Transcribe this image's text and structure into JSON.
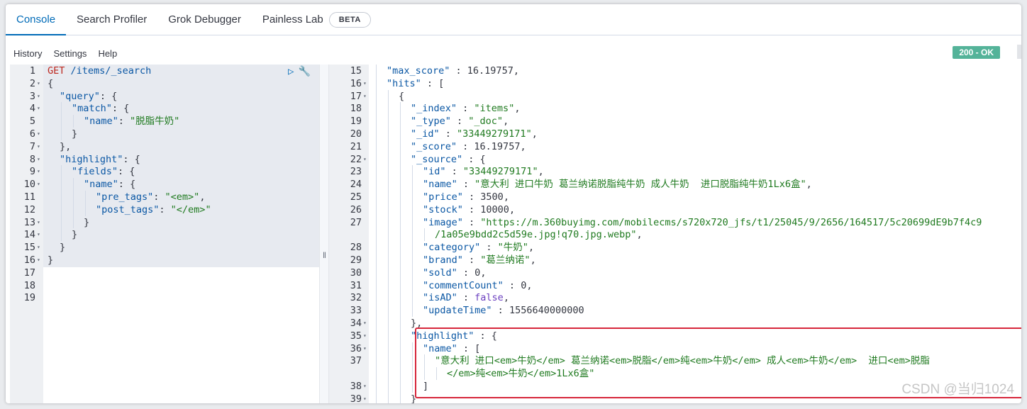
{
  "tabs": [
    "Console",
    "Search Profiler",
    "Grok Debugger",
    "Painless Lab"
  ],
  "beta_badge": "BETA",
  "menu": [
    "History",
    "Settings",
    "Help"
  ],
  "status_badge": "200 - OK",
  "request_lines": [
    {
      "n": "1",
      "fold": false,
      "ind": 0,
      "t": [
        [
          "m",
          "GET "
        ],
        [
          "k",
          "/items/_search"
        ]
      ]
    },
    {
      "n": "2",
      "fold": true,
      "ind": 0,
      "t": [
        [
          "p",
          "{"
        ]
      ]
    },
    {
      "n": "3",
      "fold": true,
      "ind": 1,
      "t": [
        [
          "k",
          "\"query\""
        ],
        [
          "p",
          ": {"
        ]
      ]
    },
    {
      "n": "4",
      "fold": true,
      "ind": 2,
      "t": [
        [
          "k",
          "\"match\""
        ],
        [
          "p",
          ": {"
        ]
      ]
    },
    {
      "n": "5",
      "fold": false,
      "ind": 3,
      "t": [
        [
          "k",
          "\"name\""
        ],
        [
          "p",
          ": "
        ],
        [
          "s",
          "\"脱脂牛奶\""
        ]
      ]
    },
    {
      "n": "6",
      "fold": true,
      "ind": 2,
      "t": [
        [
          "p",
          "}"
        ]
      ]
    },
    {
      "n": "7",
      "fold": true,
      "ind": 1,
      "t": [
        [
          "p",
          "},"
        ]
      ]
    },
    {
      "n": "8",
      "fold": true,
      "ind": 1,
      "t": [
        [
          "k",
          "\"highlight\""
        ],
        [
          "p",
          ": {"
        ]
      ]
    },
    {
      "n": "9",
      "fold": true,
      "ind": 2,
      "t": [
        [
          "k",
          "\"fields\""
        ],
        [
          "p",
          ": {"
        ]
      ]
    },
    {
      "n": "10",
      "fold": true,
      "ind": 3,
      "t": [
        [
          "k",
          "\"name\""
        ],
        [
          "p",
          ": {"
        ]
      ]
    },
    {
      "n": "11",
      "fold": false,
      "ind": 4,
      "t": [
        [
          "k",
          "\"pre_tags\""
        ],
        [
          "p",
          ": "
        ],
        [
          "s",
          "\"<em>\""
        ],
        [
          "p",
          ","
        ]
      ]
    },
    {
      "n": "12",
      "fold": false,
      "ind": 4,
      "t": [
        [
          "k",
          "\"post_tags\""
        ],
        [
          "p",
          ": "
        ],
        [
          "s",
          "\"</em>\""
        ]
      ]
    },
    {
      "n": "13",
      "fold": true,
      "ind": 3,
      "t": [
        [
          "p",
          "}"
        ]
      ]
    },
    {
      "n": "14",
      "fold": true,
      "ind": 2,
      "t": [
        [
          "p",
          "}"
        ]
      ]
    },
    {
      "n": "15",
      "fold": true,
      "ind": 1,
      "t": [
        [
          "p",
          "}"
        ]
      ]
    },
    {
      "n": "16",
      "fold": true,
      "ind": 0,
      "t": [
        [
          "p",
          "}"
        ]
      ]
    },
    {
      "n": "17",
      "fold": false,
      "ind": 0,
      "t": []
    },
    {
      "n": "18",
      "fold": false,
      "ind": 0,
      "t": []
    },
    {
      "n": "19",
      "fold": false,
      "ind": 0,
      "t": []
    }
  ],
  "response_lines": [
    {
      "n": "15",
      "fold": false,
      "ind": 1,
      "t": [
        [
          "k",
          "\"max_score\""
        ],
        [
          "p",
          " : "
        ],
        [
          "n",
          "16.19757"
        ],
        [
          "p",
          ","
        ]
      ]
    },
    {
      "n": "16",
      "fold": true,
      "ind": 1,
      "t": [
        [
          "k",
          "\"hits\""
        ],
        [
          "p",
          " : ["
        ]
      ]
    },
    {
      "n": "17",
      "fold": true,
      "ind": 2,
      "t": [
        [
          "p",
          "{"
        ]
      ]
    },
    {
      "n": "18",
      "fold": false,
      "ind": 3,
      "t": [
        [
          "k",
          "\"_index\""
        ],
        [
          "p",
          " : "
        ],
        [
          "s",
          "\"items\""
        ],
        [
          "p",
          ","
        ]
      ]
    },
    {
      "n": "19",
      "fold": false,
      "ind": 3,
      "t": [
        [
          "k",
          "\"_type\""
        ],
        [
          "p",
          " : "
        ],
        [
          "s",
          "\"_doc\""
        ],
        [
          "p",
          ","
        ]
      ]
    },
    {
      "n": "20",
      "fold": false,
      "ind": 3,
      "t": [
        [
          "k",
          "\"_id\""
        ],
        [
          "p",
          " : "
        ],
        [
          "s",
          "\"33449279171\""
        ],
        [
          "p",
          ","
        ]
      ]
    },
    {
      "n": "21",
      "fold": false,
      "ind": 3,
      "t": [
        [
          "k",
          "\"_score\""
        ],
        [
          "p",
          " : "
        ],
        [
          "n",
          "16.19757"
        ],
        [
          "p",
          ","
        ]
      ]
    },
    {
      "n": "22",
      "fold": true,
      "ind": 3,
      "t": [
        [
          "k",
          "\"_source\""
        ],
        [
          "p",
          " : {"
        ]
      ]
    },
    {
      "n": "23",
      "fold": false,
      "ind": 4,
      "t": [
        [
          "k",
          "\"id\""
        ],
        [
          "p",
          " : "
        ],
        [
          "s",
          "\"33449279171\""
        ],
        [
          "p",
          ","
        ]
      ]
    },
    {
      "n": "24",
      "fold": false,
      "ind": 4,
      "t": [
        [
          "k",
          "\"name\""
        ],
        [
          "p",
          " : "
        ],
        [
          "s",
          "\"意大利 进口牛奶 葛兰纳诺脱脂纯牛奶 成人牛奶  进口脱脂纯牛奶1Lx6盒\""
        ],
        [
          "p",
          ","
        ]
      ]
    },
    {
      "n": "25",
      "fold": false,
      "ind": 4,
      "t": [
        [
          "k",
          "\"price\""
        ],
        [
          "p",
          " : "
        ],
        [
          "n",
          "3500"
        ],
        [
          "p",
          ","
        ]
      ]
    },
    {
      "n": "26",
      "fold": false,
      "ind": 4,
      "t": [
        [
          "k",
          "\"stock\""
        ],
        [
          "p",
          " : "
        ],
        [
          "n",
          "10000"
        ],
        [
          "p",
          ","
        ]
      ]
    },
    {
      "n": "27",
      "fold": false,
      "ind": 4,
      "t": [
        [
          "k",
          "\"image\""
        ],
        [
          "p",
          " : "
        ],
        [
          "s",
          "\"https://m.360buyimg.com/mobilecms/s720x720_jfs/t1/25045/9/2656/164517/5c20699dE9b7f4c9"
        ]
      ]
    },
    {
      "n": "",
      "fold": false,
      "ind": 5,
      "t": [
        [
          "s",
          "/1a05e9bdd2c5d59e.jpg!q70.jpg.webp\""
        ],
        [
          "p",
          ","
        ]
      ]
    },
    {
      "n": "28",
      "fold": false,
      "ind": 4,
      "t": [
        [
          "k",
          "\"category\""
        ],
        [
          "p",
          " : "
        ],
        [
          "s",
          "\"牛奶\""
        ],
        [
          "p",
          ","
        ]
      ]
    },
    {
      "n": "29",
      "fold": false,
      "ind": 4,
      "t": [
        [
          "k",
          "\"brand\""
        ],
        [
          "p",
          " : "
        ],
        [
          "s",
          "\"葛兰纳诺\""
        ],
        [
          "p",
          ","
        ]
      ]
    },
    {
      "n": "30",
      "fold": false,
      "ind": 4,
      "t": [
        [
          "k",
          "\"sold\""
        ],
        [
          "p",
          " : "
        ],
        [
          "n",
          "0"
        ],
        [
          "p",
          ","
        ]
      ]
    },
    {
      "n": "31",
      "fold": false,
      "ind": 4,
      "t": [
        [
          "k",
          "\"commentCount\""
        ],
        [
          "p",
          " : "
        ],
        [
          "n",
          "0"
        ],
        [
          "p",
          ","
        ]
      ]
    },
    {
      "n": "32",
      "fold": false,
      "ind": 4,
      "t": [
        [
          "k",
          "\"isAD\""
        ],
        [
          "p",
          " : "
        ],
        [
          "b",
          "false"
        ],
        [
          "p",
          ","
        ]
      ]
    },
    {
      "n": "33",
      "fold": false,
      "ind": 4,
      "t": [
        [
          "k",
          "\"updateTime\""
        ],
        [
          "p",
          " : "
        ],
        [
          "n",
          "1556640000000"
        ]
      ]
    },
    {
      "n": "34",
      "fold": true,
      "ind": 3,
      "t": [
        [
          "p",
          "},"
        ]
      ]
    },
    {
      "n": "35",
      "fold": true,
      "ind": 3,
      "t": [
        [
          "k",
          "\"highlight\""
        ],
        [
          "p",
          " : {"
        ]
      ]
    },
    {
      "n": "36",
      "fold": true,
      "ind": 4,
      "t": [
        [
          "k",
          "\"name\""
        ],
        [
          "p",
          " : ["
        ]
      ]
    },
    {
      "n": "37",
      "fold": false,
      "ind": 5,
      "t": [
        [
          "s",
          "\"意大利 进口<em>牛奶</em> 葛兰纳诺<em>脱脂</em>纯<em>牛奶</em> 成人<em>牛奶</em>  进口<em>脱脂"
        ]
      ]
    },
    {
      "n": "",
      "fold": false,
      "ind": 6,
      "t": [
        [
          "s",
          "</em>纯<em>牛奶</em>1Lx6盒\""
        ]
      ]
    },
    {
      "n": "38",
      "fold": true,
      "ind": 4,
      "t": [
        [
          "p",
          "]"
        ]
      ]
    },
    {
      "n": "39",
      "fold": true,
      "ind": 3,
      "t": [
        [
          "p",
          "}"
        ]
      ]
    }
  ],
  "watermark": "CSDN @当归1024"
}
